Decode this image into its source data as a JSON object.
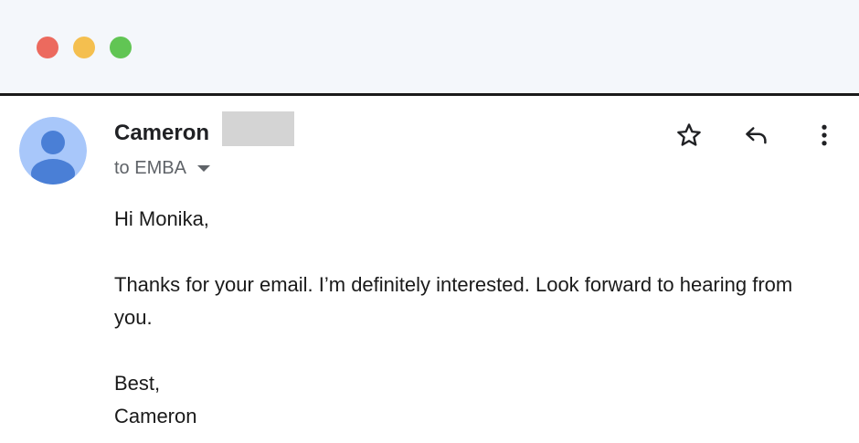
{
  "window": {
    "controls": {
      "close_color": "#ec6a5e",
      "minimize_color": "#f4bf4f",
      "zoom_color": "#61c554"
    }
  },
  "message": {
    "sender": {
      "first_name": "Cameron",
      "avatar_icon": "person-avatar-icon",
      "avatar_bg": "#a8c7fa",
      "avatar_fg": "#4a7fd6"
    },
    "recipient_text": "to EMBA",
    "actions": {
      "star_icon": "star-outline-icon",
      "reply_icon": "reply-arrow-icon",
      "more_icon": "more-vertical-icon"
    },
    "body": {
      "greeting": "Hi Monika,",
      "paragraph": "Thanks for your email. I’m definitely interested. Look forward to hearing from you.",
      "closing": "Best,",
      "signature": "Cameron"
    }
  }
}
